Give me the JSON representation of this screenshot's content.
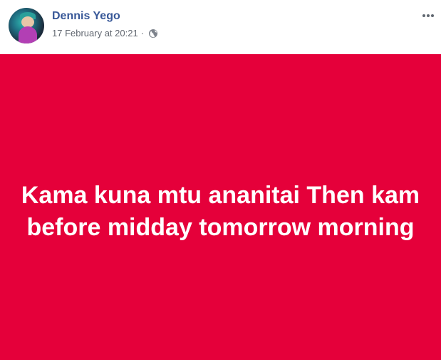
{
  "post": {
    "author": "Dennis Yego",
    "date": "17 February at 20:21",
    "separator": "·",
    "privacy_icon": "globe-icon",
    "more_icon": "more-options-icon",
    "background_color": "#e5003a",
    "text": "Kama kuna mtu ananitai Then kam before midday tomorrow morning"
  }
}
